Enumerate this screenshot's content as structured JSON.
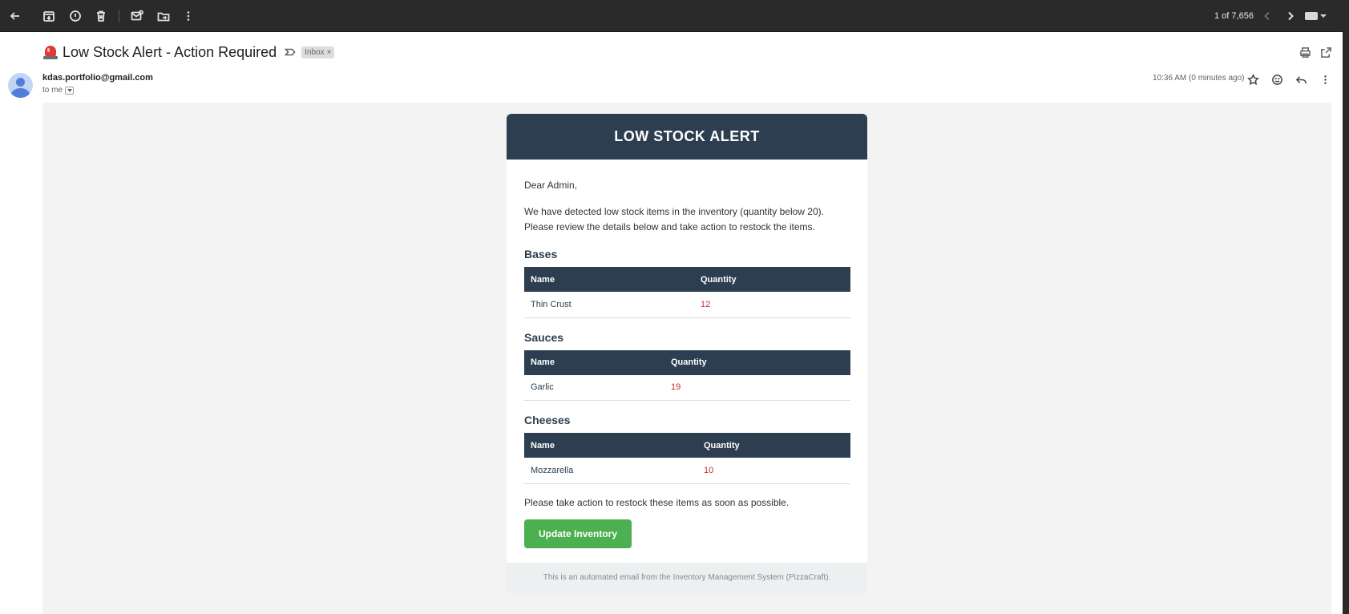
{
  "toolbar": {
    "pager_text": "1 of 7,656",
    "icons": [
      "back-arrow-icon",
      "archive-icon",
      "report-spam-icon",
      "delete-icon",
      "mark-unread-icon",
      "move-to-icon",
      "more-vert-icon",
      "prev-chevron-icon",
      "next-chevron-icon",
      "keyboard-icon"
    ]
  },
  "email": {
    "subject": "Low Stock Alert - Action Required",
    "label_chip": "Inbox",
    "label_chip_close": "×",
    "sender": "kdas.portfolio@gmail.com",
    "recipient": "to me",
    "timestamp": "10:36 AM (0 minutes ago)"
  },
  "body": {
    "header_title": "LOW STOCK ALERT",
    "greeting": "Dear Admin,",
    "intro_line1": "We have detected low stock items in the inventory (quantity below 20).",
    "intro_line2": "Please review the details below and take action to restock the items.",
    "sections": [
      {
        "title": "Bases",
        "col_name": "Name",
        "col_qty": "Quantity",
        "rows": [
          {
            "name": "Thin Crust",
            "qty": "12"
          }
        ]
      },
      {
        "title": "Sauces",
        "col_name": "Name",
        "col_qty": "Quantity",
        "rows": [
          {
            "name": "Garlic",
            "qty": "19"
          }
        ]
      },
      {
        "title": "Cheeses",
        "col_name": "Name",
        "col_qty": "Quantity",
        "rows": [
          {
            "name": "Mozzarella",
            "qty": "10"
          }
        ]
      }
    ],
    "closing": "Please take action to restock these items as soon as possible.",
    "button_label": "Update Inventory",
    "footer": "This is an automated email from the Inventory Management System (PizzaCraft)."
  },
  "colors": {
    "toolbar_bg": "#2a2a2a",
    "header_bg": "#2c3e50",
    "button_green": "#4caf50",
    "quantity_red": "#c62828",
    "canvas_bg": "#f3f3f3"
  }
}
